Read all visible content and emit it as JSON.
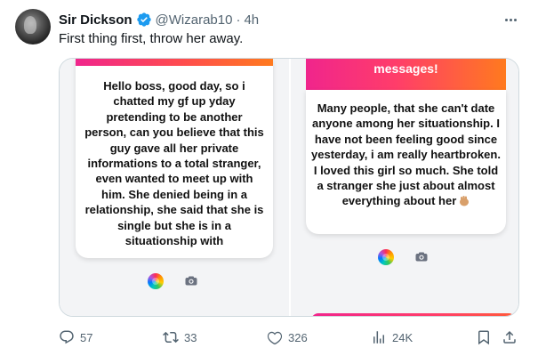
{
  "tweet": {
    "display_name": "Sir Dickson",
    "handle": "@Wizarab10",
    "separator": "·",
    "time": "4h",
    "text": "First thing first, throw her away."
  },
  "icons": {
    "avatar": "profile-photo",
    "verified": "verified-badge-icon",
    "more": "more-options-icon",
    "reply": "reply-icon",
    "retweet": "retweet-icon",
    "like": "heart-icon",
    "views": "views-chart-icon",
    "bookmark": "bookmark-icon",
    "share": "share-icon"
  },
  "media": {
    "left": {
      "message": "Hello boss, good day, so i chatted my gf up yday pretending to be another person, can you believe that this guy gave all her private informations to a total stranger, even wanted to meet up with him. She denied being in a relationship, she said that she is single but she is in a situationship with"
    },
    "right": {
      "banner": "messages!",
      "message": "Many people, that she can't date anyone among her situationship. I have not been feeling good since yesterday, i am really heartbroken. I loved this girl so much. She told a stranger she just about almost everything about her"
    }
  },
  "actions": {
    "replies": "57",
    "retweets": "33",
    "likes": "326",
    "views": "24K"
  },
  "colors": {
    "verified": "#1d9bf0",
    "muted_text": "#536471",
    "border": "#cfd9de",
    "gradient_pink": "#f0258c",
    "gradient_orange": "#ff7a1e"
  }
}
